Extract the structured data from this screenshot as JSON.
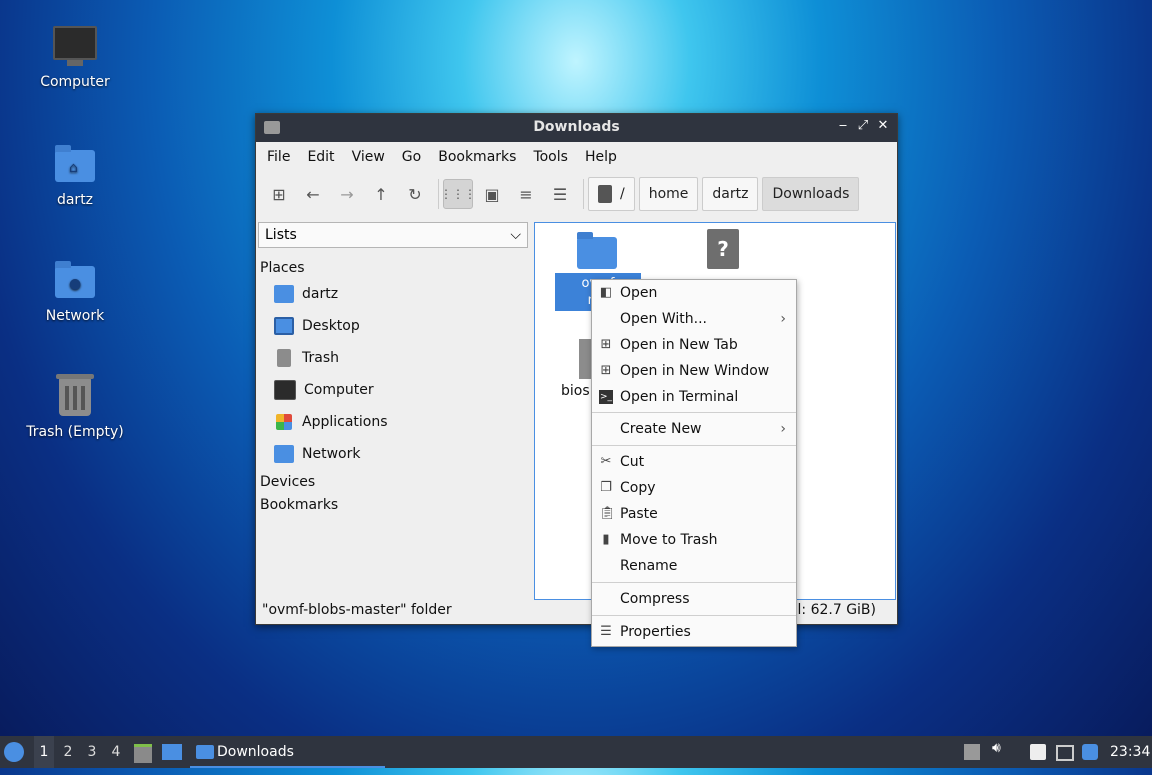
{
  "desktop": {
    "icons": [
      {
        "label": "Computer"
      },
      {
        "label": "dartz"
      },
      {
        "label": "Network"
      },
      {
        "label": "Trash (Empty)"
      }
    ]
  },
  "window": {
    "title": "Downloads",
    "controls": {
      "minimize": "‒",
      "maximize": "⤢",
      "close": "✕"
    }
  },
  "menubar": {
    "items": [
      "File",
      "Edit",
      "View",
      "Go",
      "Bookmarks",
      "Tools",
      "Help"
    ]
  },
  "toolbar": {
    "path_root": "/",
    "breadcrumbs": [
      "home",
      "dartz",
      "Downloads"
    ]
  },
  "sidebar": {
    "selector": "Lists",
    "places_heading": "Places",
    "places": [
      "dartz",
      "Desktop",
      "Trash",
      "Computer",
      "Applications",
      "Network"
    ],
    "devices_heading": "Devices",
    "bookmarks_heading": "Bookmarks"
  },
  "files": {
    "selected_label_line1": "ovmf",
    "selected_label_line2": "ma",
    "partial_label": "bios"
  },
  "status": {
    "left": "\"ovmf-blobs-master\" folder",
    "right": "al: 62.7 GiB)"
  },
  "context_menu": {
    "open": "Open",
    "open_with": "Open With...",
    "open_new_tab": "Open in New Tab",
    "open_new_window": "Open in New Window",
    "open_terminal": "Open in Terminal",
    "create_new": "Create New",
    "cut": "Cut",
    "copy": "Copy",
    "paste": "Paste",
    "move_to_trash": "Move to Trash",
    "rename": "Rename",
    "compress": "Compress",
    "properties": "Properties"
  },
  "taskbar": {
    "workspaces": [
      "1",
      "2",
      "3",
      "4"
    ],
    "task": "Downloads",
    "clock": "23:34"
  },
  "colors": {
    "accent": "#4a8fe2",
    "titlebar": "#2f343f",
    "selection": "#3c82d8"
  }
}
